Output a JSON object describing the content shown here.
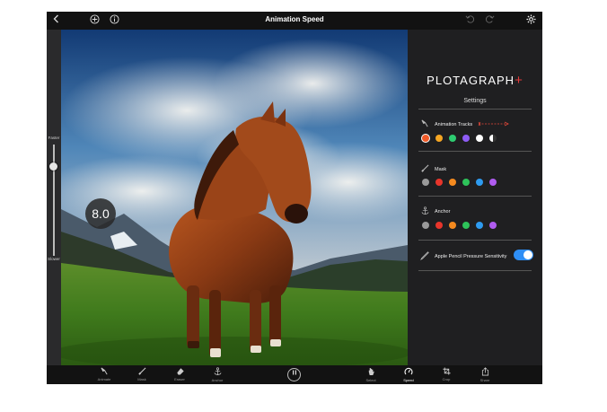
{
  "topbar": {
    "title": "Animation Speed",
    "icons": [
      "back-chevron-icon",
      "add-circle-icon",
      "info-icon",
      "undo-icon",
      "redo-icon",
      "settings-gear-icon"
    ]
  },
  "speed_slider": {
    "top_label": "Faster",
    "bottom_label": "Slower",
    "value_text": "8.0"
  },
  "panel": {
    "logo_text": "PLOTAGRAPH",
    "logo_plus": "+",
    "heading": "Settings",
    "animation_tracks": {
      "label": "Animation Tracks",
      "colors": [
        "#f05a28",
        "#f5a623",
        "#2ecc71",
        "#8e5cf5",
        "#ffffff",
        "half-dark"
      ]
    },
    "mask": {
      "label": "Mask",
      "colors": [
        "#9a9a9a",
        "#e8352b",
        "#f58a1f",
        "#2ec35a",
        "#2e9bf0",
        "#b05cf0"
      ]
    },
    "anchor": {
      "label": "Anchor",
      "colors": [
        "#9a9a9a",
        "#e8352b",
        "#f58a1f",
        "#2ec35a",
        "#2e9bf0",
        "#b05cf0"
      ]
    },
    "pencil": {
      "label": "Apple Pencil Pressure Sensitivity",
      "enabled": true
    }
  },
  "bottombar": {
    "tools": [
      {
        "label": "Animate",
        "icon": "animate-icon"
      },
      {
        "label": "Mask",
        "icon": "brush-icon"
      },
      {
        "label": "Eraser",
        "icon": "eraser-icon"
      },
      {
        "label": "Anchor",
        "icon": "anchor-icon"
      },
      {
        "label": "Select",
        "icon": "hand-icon"
      },
      {
        "label": "Speed",
        "icon": "speed-icon"
      },
      {
        "label": "Crop",
        "icon": "crop-icon"
      },
      {
        "label": "Share",
        "icon": "share-icon"
      }
    ],
    "active": "Speed"
  }
}
